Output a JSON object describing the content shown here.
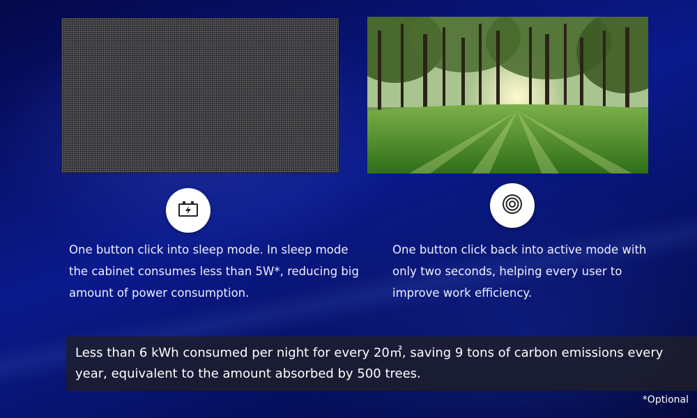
{
  "sections": [
    {
      "icon": "battery-charging-icon",
      "description": "One button click into sleep mode. In sleep mode the cabinet consumes less than 5W*, reducing big amount of power consumption."
    },
    {
      "icon": "concentric-circles-icon",
      "description": "One button click back into active mode with only two seconds, helping every user to improve work efficiency."
    }
  ],
  "summary": "Less than 6 kWh consumed per night for every 20㎡, saving 9 tons of carbon emissions every year, equivalent to the amount absorbed by 500 trees.",
  "footnote": "*Optional",
  "colors": {
    "background": "#0a1a8c",
    "panel_off": "#5a5a5c",
    "summary_bar": "#1e1e28"
  }
}
